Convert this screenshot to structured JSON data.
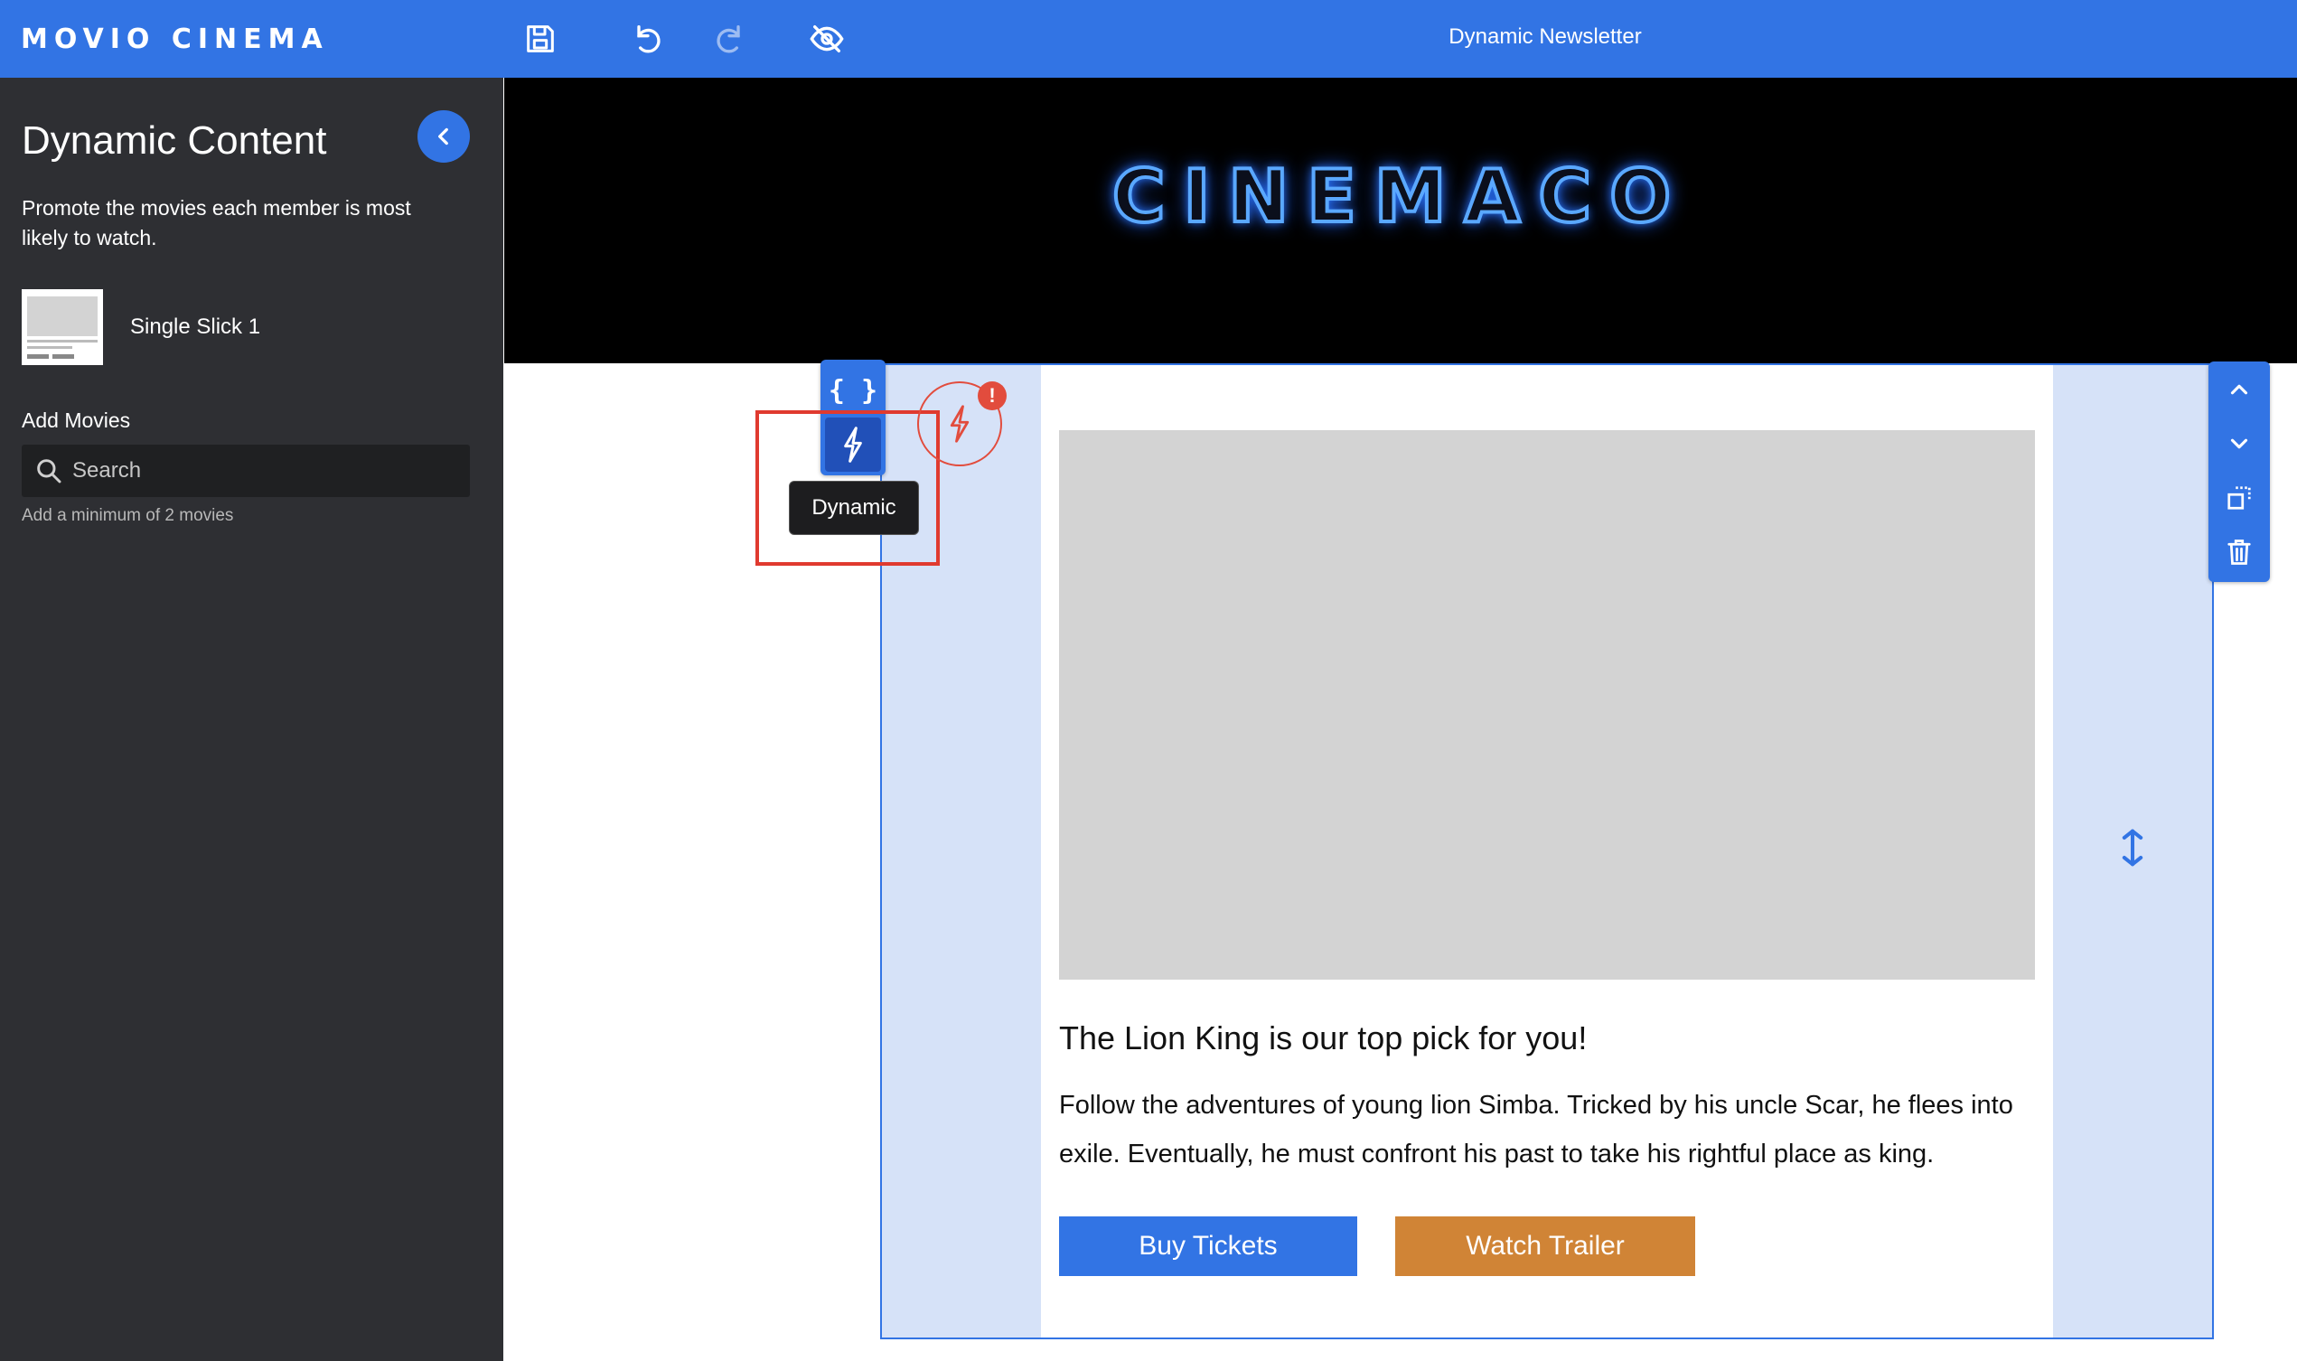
{
  "topbar": {
    "brand": "MOVIO CINEMA",
    "document_title": "Dynamic Newsletter",
    "icons": [
      "save-icon",
      "undo-icon",
      "redo-icon",
      "hide-preview-icon"
    ],
    "color": "#3274e4"
  },
  "sidebar": {
    "title": "Dynamic Content",
    "description": "Promote the movies each member is most likely to watch.",
    "template_name": "Single Slick 1",
    "add_movies_label": "Add Movies",
    "search_placeholder": "Search",
    "hint": "Add a minimum of 2 movies",
    "background": "#2e2f33"
  },
  "canvas": {
    "hero_logo": "CINEMACO",
    "headline": "The Lion King is our top pick for you!",
    "body": "Follow the adventures of young lion Simba. Tricked by his uncle Scar, he flees into exile. Eventually, he must confront his past to take his rightful place as king.",
    "buttons": {
      "buy": "Buy Tickets",
      "trailer": "Watch Trailer"
    },
    "colors": {
      "buy_button": "#3274e4",
      "trailer_button": "#d08436",
      "module_highlight": "#d6e2f8"
    }
  },
  "module_tools": {
    "code_label": "{ }",
    "tooltip": "Dynamic",
    "warning_badge": "!",
    "right_icons": [
      "chevron-up-icon",
      "chevron-down-icon",
      "duplicate-icon",
      "trash-icon"
    ]
  }
}
